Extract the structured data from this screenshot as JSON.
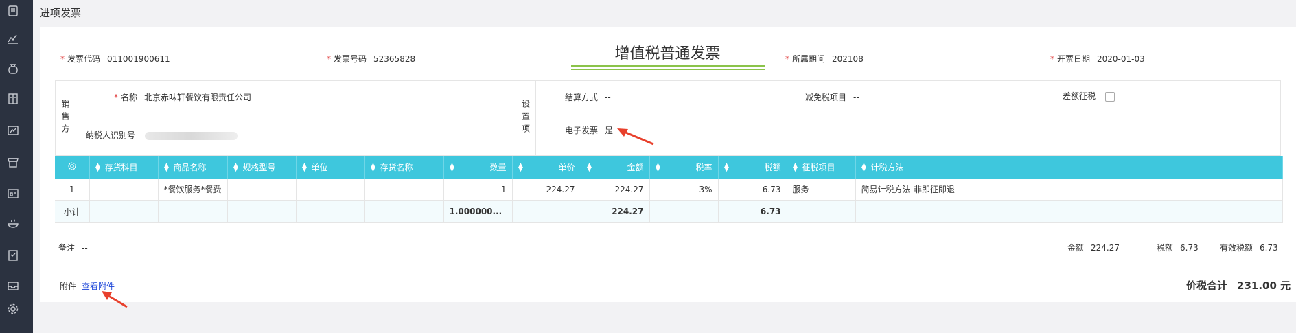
{
  "page": {
    "title": "进项发票"
  },
  "sidebar": {
    "icons": [
      "invoice-icon",
      "chart-icon",
      "money-bag-icon",
      "ledger-icon",
      "report-icon",
      "store-icon",
      "dashboard-icon",
      "bowl-icon",
      "receipt-icon",
      "inbox-icon",
      "gear-icon"
    ]
  },
  "invoice": {
    "code_label": "发票代码",
    "code": "011001900611",
    "number_label": "发票号码",
    "number": "52365828",
    "title": "增值税普通发票",
    "period_label": "所属期间",
    "period": "202108",
    "date_label": "开票日期",
    "date": "2020-01-03",
    "required_mark": "*"
  },
  "seller": {
    "side_label": "销售方",
    "name_label": "名称",
    "name": "北京赤味轩餐饮有限责任公司",
    "tax_id_label": "纳税人识别号"
  },
  "settings": {
    "side_label": "设置项",
    "settlement_label": "结算方式",
    "settlement": "--",
    "exemption_label": "减免税项目",
    "exemption": "--",
    "diff_tax_label": "差额征税",
    "e_invoice_label": "电子发票",
    "e_invoice": "是"
  },
  "table": {
    "columns": [
      "存货科目",
      "商品名称",
      "规格型号",
      "单位",
      "存货名称",
      "数量",
      "单价",
      "金额",
      "税率",
      "税额",
      "征税项目",
      "计税方法"
    ],
    "rows": [
      [
        "1",
        "",
        "*餐饮服务*餐费",
        "",
        "",
        "",
        "1",
        "224.27",
        "224.27",
        "3%",
        "6.73",
        "服务",
        "简易计税方法-非即征即退"
      ]
    ],
    "subtotal": [
      "小计",
      "",
      "",
      "",
      "",
      "",
      "1.000000...",
      "",
      "224.27",
      "",
      "6.73",
      "",
      ""
    ]
  },
  "footer": {
    "remark_label": "备注",
    "remark": "--",
    "amount_label": "金额",
    "amount": "224.27",
    "tax_label": "税额",
    "tax": "6.73",
    "valid_tax_label": "有效税额",
    "valid_tax": "6.73",
    "attach_label": "附件",
    "attach_link": "查看附件",
    "total_label": "价税合计",
    "total": "231.00 元"
  },
  "colors": {
    "header": "#3ec7dd",
    "accent_line": "#8bc34a",
    "required": "#e03a3a",
    "link": "#1a44d8",
    "sidebar": "#2b3240",
    "arrow": "#e8402c"
  }
}
